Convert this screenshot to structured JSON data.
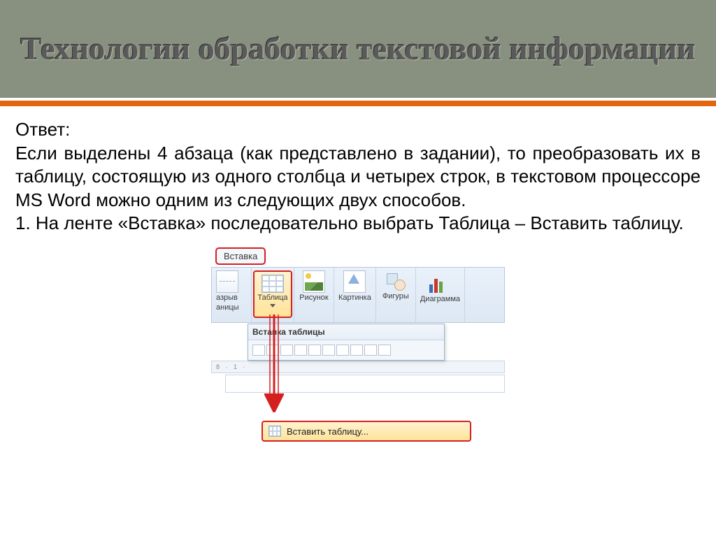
{
  "header": {
    "title": "Технологии обработки текстовой информации"
  },
  "body": {
    "answer_label": "Ответ:",
    "paragraph1": "Если выделены 4 абзаца (как представлено в задании), то преобразовать их в таблицу, состоящую из одного столбца и четырех строк, в текстовом процессоре MS Word можно одним из следующих двух способов.",
    "paragraph2": "1. На ленте «Вставка» последовательно выбрать Таблица – Вставить таблицу."
  },
  "figure": {
    "tab_label": "Вставка",
    "ribbon": {
      "break_top": "азрыв",
      "break_bottom": "аницы",
      "table": "Таблица",
      "picture": "Рисунок",
      "clipart": "Картинка",
      "shapes": "Фигуры",
      "chart": "Диаграмма"
    },
    "dropdown_title": "Вставка таблицы",
    "ruler_text": "8 · 1 ·",
    "menu_item": "Вставить таблицу..."
  }
}
